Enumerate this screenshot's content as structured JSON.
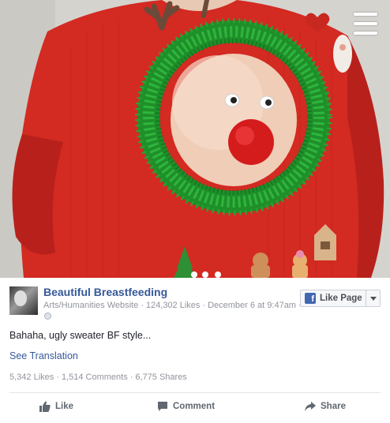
{
  "post": {
    "page_name": "Beautiful Breastfeeding",
    "category": "Arts/Humanities Website",
    "page_likes": "124,302 Likes",
    "date": "December 6 at 9:47am",
    "like_page_label": "Like Page",
    "text": "Bahaha, ugly sweater BF style...",
    "see_translation": "See Translation",
    "likes": "5,342 Likes",
    "comments": "1,514 Comments",
    "shares": "6,775 Shares"
  },
  "actions": {
    "like": "Like",
    "comment": "Comment",
    "share": "Share"
  },
  "icons": {
    "menu": "menu-icon",
    "globe": "globe-icon",
    "facebook": "facebook-icon",
    "thumb": "thumbs-up-icon",
    "comment": "comment-icon",
    "share": "share-icon"
  },
  "colors": {
    "link_blue": "#365899",
    "fb_blue": "#4267b2",
    "meta_gray": "#90949c",
    "sweater_red": "#d62a22",
    "tinsel_green": "#1e9a2c"
  }
}
